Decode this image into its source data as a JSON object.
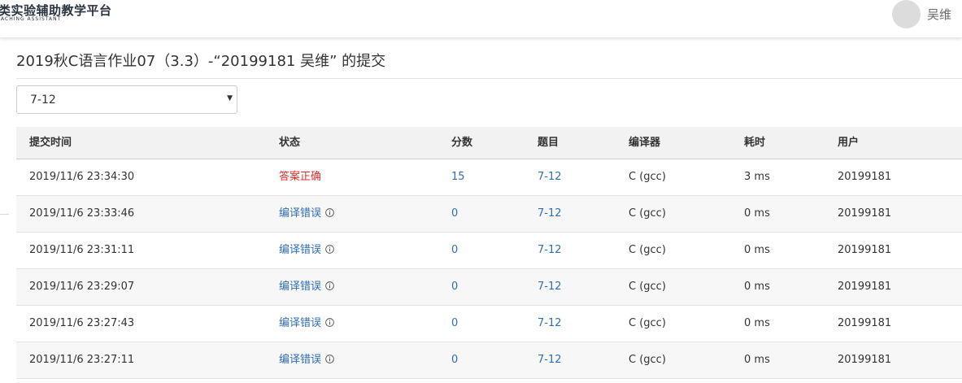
{
  "header": {
    "logo_title": "类实验辅助教学平台",
    "logo_subtitle": "ACHING ASSISTANT",
    "username": "吴维"
  },
  "page": {
    "title": "2019秋C语言作业07（3.3）-“20199181 吴维” 的提交"
  },
  "problem_select": {
    "value": "7-12"
  },
  "table": {
    "columns": [
      "提交时间",
      "状态",
      "分数",
      "题目",
      "编译器",
      "耗时",
      "用户"
    ],
    "rows": [
      {
        "time": "2019/11/6 23:34:30",
        "status": "答案正确",
        "status_type": "accepted",
        "score": "15",
        "problem": "7-12",
        "compiler": "C (gcc)",
        "duration": "3 ms",
        "user": "20199181"
      },
      {
        "time": "2019/11/6 23:33:46",
        "status": "编译错误",
        "status_type": "compile-error",
        "score": "0",
        "problem": "7-12",
        "compiler": "C (gcc)",
        "duration": "0 ms",
        "user": "20199181"
      },
      {
        "time": "2019/11/6 23:31:11",
        "status": "编译错误",
        "status_type": "compile-error",
        "score": "0",
        "problem": "7-12",
        "compiler": "C (gcc)",
        "duration": "0 ms",
        "user": "20199181"
      },
      {
        "time": "2019/11/6 23:29:07",
        "status": "编译错误",
        "status_type": "compile-error",
        "score": "0",
        "problem": "7-12",
        "compiler": "C (gcc)",
        "duration": "0 ms",
        "user": "20199181"
      },
      {
        "time": "2019/11/6 23:27:43",
        "status": "编译错误",
        "status_type": "compile-error",
        "score": "0",
        "problem": "7-12",
        "compiler": "C (gcc)",
        "duration": "0 ms",
        "user": "20199181"
      },
      {
        "time": "2019/11/6 23:27:11",
        "status": "编译错误",
        "status_type": "compile-error",
        "score": "0",
        "problem": "7-12",
        "compiler": "C (gcc)",
        "duration": "0 ms",
        "user": "20199181"
      }
    ]
  },
  "colors": {
    "accepted": "#d9302c",
    "link": "#2f6eb5",
    "header_bg": "#f2f2f2",
    "alt_row_bg": "#f7f7f7"
  },
  "icons": {
    "select_caret": "caret-down-icon",
    "status_info": "info-circle-icon"
  }
}
